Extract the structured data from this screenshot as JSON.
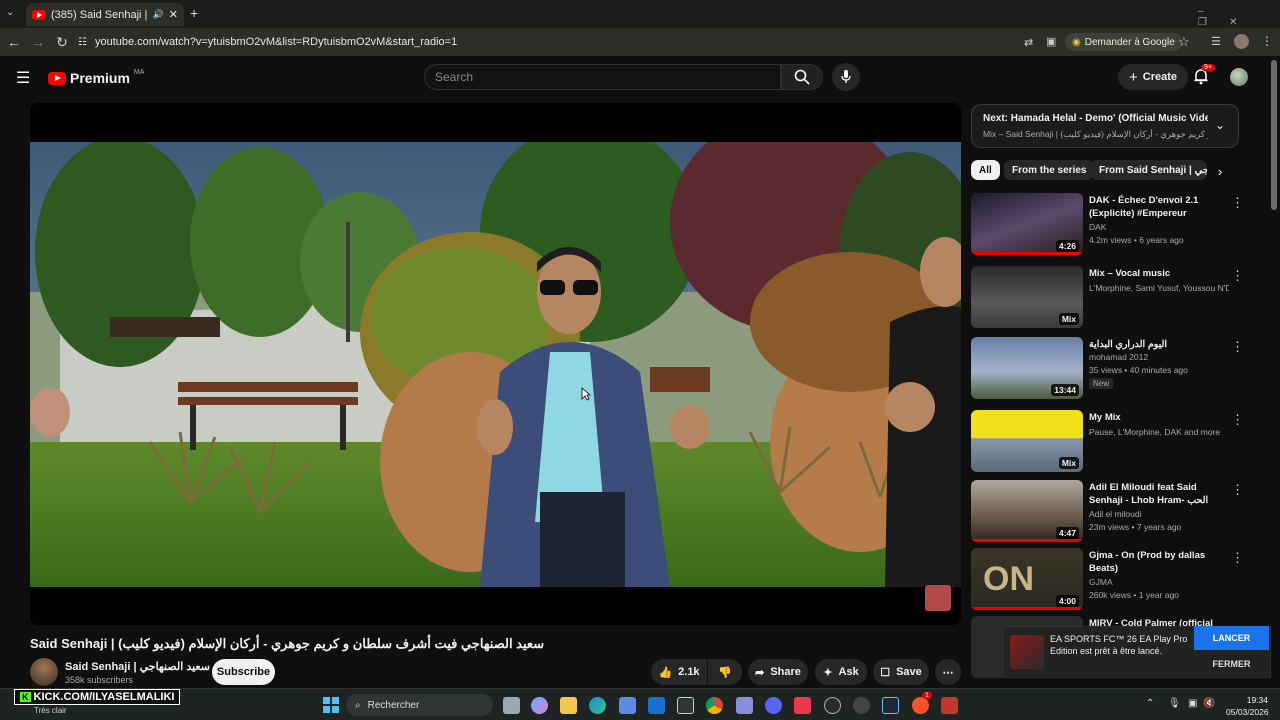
{
  "tab": {
    "title": "(385) Said Senhaji | (سعيد الصنهاجي فيت أشرف سلطان و كريم جوهري - أركان الإسلام (فيديو كليب"
  },
  "address": {
    "url": "youtube.com/watch?v=ytuisbmO2vM&list=RDytuisbmO2vM&start_radio=1",
    "google_button": "Demander à Google"
  },
  "header": {
    "logo": "Premium",
    "region": "MA",
    "search_placeholder": "Search",
    "create": "Create",
    "notif_count": "9+"
  },
  "video": {
    "title": "Said Senhaji | سعيد الصنهاجي فيت أشرف سلطان و كريم جوهري - أركان الإسلام (فيديو كليب)",
    "channel": "Said Senhaji | سعيد الصنهاجي",
    "subscribers": "358k subscribers",
    "subscribe": "Subscribe",
    "likes": "2.1k",
    "share": "Share",
    "ask": "Ask",
    "save": "Save"
  },
  "next": {
    "title": "Next: Hamada Helal - Demo' (Official Music Video) /...",
    "sub": "Mix – Said Senhaji | سعيد الصنهاجي فيت أشرف سلطان و كريم جوهري - أركان الإسلام (فيديو كليب)"
  },
  "chips": [
    "All",
    "From the series",
    "From Said Senhaji | سعيد الصنهاجي"
  ],
  "recs": [
    {
      "title": "DAK - Échec D'envoi 2.1 (Explicite) #Empereur",
      "channel": "DAK",
      "meta": "4.2m views • 6 years ago",
      "badge": "4:26"
    },
    {
      "title": "Mix – Vocal music",
      "channel": "L'Morphine, Sami Yusuf, Youssou N'Dour...",
      "meta": "",
      "badge": "Mix"
    },
    {
      "title": "اليوم الدراري البداية",
      "channel": "mohamad 2012",
      "meta": "35 views • 40 minutes ago",
      "badge": "13:44",
      "new": "New"
    },
    {
      "title": "My Mix",
      "channel": "Pause, L'Morphine, DAK and more",
      "meta": "",
      "badge": "Mix"
    },
    {
      "title": "Adil El Miloudi feat Said Senhaji - Lhob Hram- الحب حرام ...",
      "channel": "Adil el miloudi",
      "meta": "23m views • 7 years ago",
      "badge": "4:47"
    },
    {
      "title": "Gjma - On (Prod by dallas Beats)",
      "channel": "GJMA",
      "meta": "260k views • 1 year ago",
      "badge": "4:00"
    },
    {
      "title": "MIRV - Cold Palmer (official",
      "channel": "",
      "meta": "",
      "badge": ""
    }
  ],
  "notification": {
    "text": "EA SPORTS FC™ 26 EA Play Pro Edition est prêt à être lancé.",
    "launch": "LANCER",
    "close": "FERMER"
  },
  "taskbar": {
    "search": "Rechercher",
    "time": "19:34",
    "date": "05/03/2026",
    "weather": "Très clair",
    "overlay": "KICK.COM/ILYASELMALIKI",
    "badge": "1"
  }
}
